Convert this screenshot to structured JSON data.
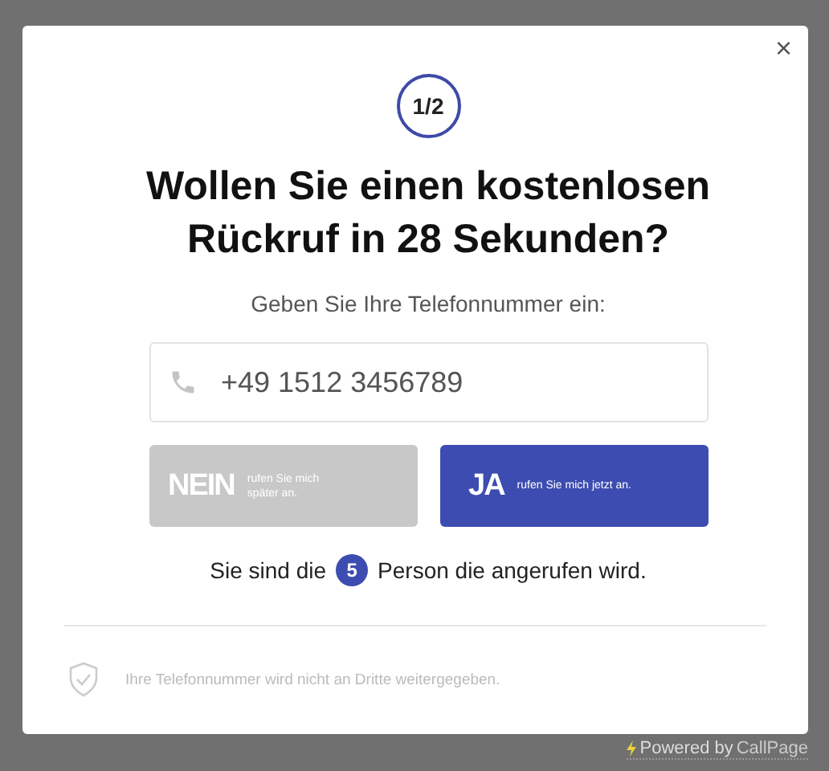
{
  "close": "×",
  "step": "1/2",
  "title": "Wollen Sie einen kostenlosen Rückruf in 28 Sekunden?",
  "subtitle": "Geben Sie Ihre Telefonnummer ein:",
  "phone_field": {
    "value": "+49 1512 3456789"
  },
  "buttons": [
    {
      "kind": "decline",
      "label": "NEIN",
      "sublabel": "rufen Sie mich später an."
    },
    {
      "kind": "accept",
      "label": "JA",
      "sublabel": "rufen Sie mich jetzt an."
    }
  ],
  "queue": {
    "before": "Sie sind die",
    "count": "5",
    "after": "Person die angerufen wird."
  },
  "privacy_note": "Ihre Telefonnummer wird nicht an Dritte weitergegeben.",
  "powered_by": {
    "text": "Powered by",
    "brand": "CallPage"
  }
}
